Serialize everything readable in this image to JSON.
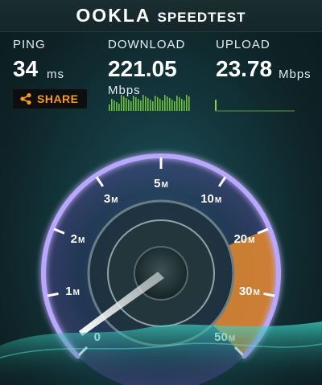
{
  "header": {
    "brand_left": "OOKLA",
    "brand_right": "SPEEDTEST"
  },
  "ping": {
    "label": "PING",
    "value": "34",
    "unit": "ms"
  },
  "download": {
    "label": "DOWNLOAD",
    "value": "221.05",
    "unit": "Mbps"
  },
  "upload": {
    "label": "UPLOAD",
    "value": "23.78",
    "unit": "Mbps"
  },
  "share": {
    "label": "SHARE",
    "icon": "share-icon"
  },
  "gauge": {
    "ticks": [
      {
        "num": "0",
        "unit": ""
      },
      {
        "num": "1",
        "unit": "M"
      },
      {
        "num": "2",
        "unit": "M"
      },
      {
        "num": "3",
        "unit": "M"
      },
      {
        "num": "5",
        "unit": "M"
      },
      {
        "num": "10",
        "unit": "M"
      },
      {
        "num": "20",
        "unit": "M"
      },
      {
        "num": "30",
        "unit": "M"
      },
      {
        "num": "50",
        "unit": "M"
      }
    ],
    "colors": {
      "arc": "#b9a6ff",
      "active": "#e88b2e",
      "text": "#ffffff"
    }
  }
}
